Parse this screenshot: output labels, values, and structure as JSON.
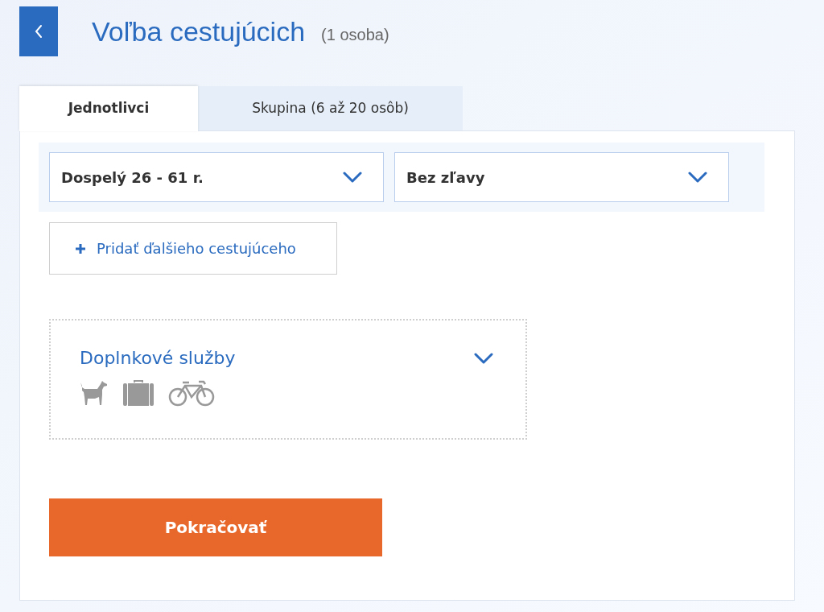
{
  "header": {
    "title": "Voľba cestujúcich",
    "count": "(1 osoba)"
  },
  "tabs": [
    {
      "label": "Jednotlivci",
      "selected": true
    },
    {
      "label": "Skupina (6 až 20 osôb)",
      "selected": false
    }
  ],
  "passenger": {
    "category": "Dospelý 26 - 61 r.",
    "discount": "Bez zľavy"
  },
  "add_button": "Pridať ďalšieho cestujúceho",
  "extras": {
    "title": "Doplnkové služby",
    "expanded": false
  },
  "continue_button": "Pokračovať"
}
